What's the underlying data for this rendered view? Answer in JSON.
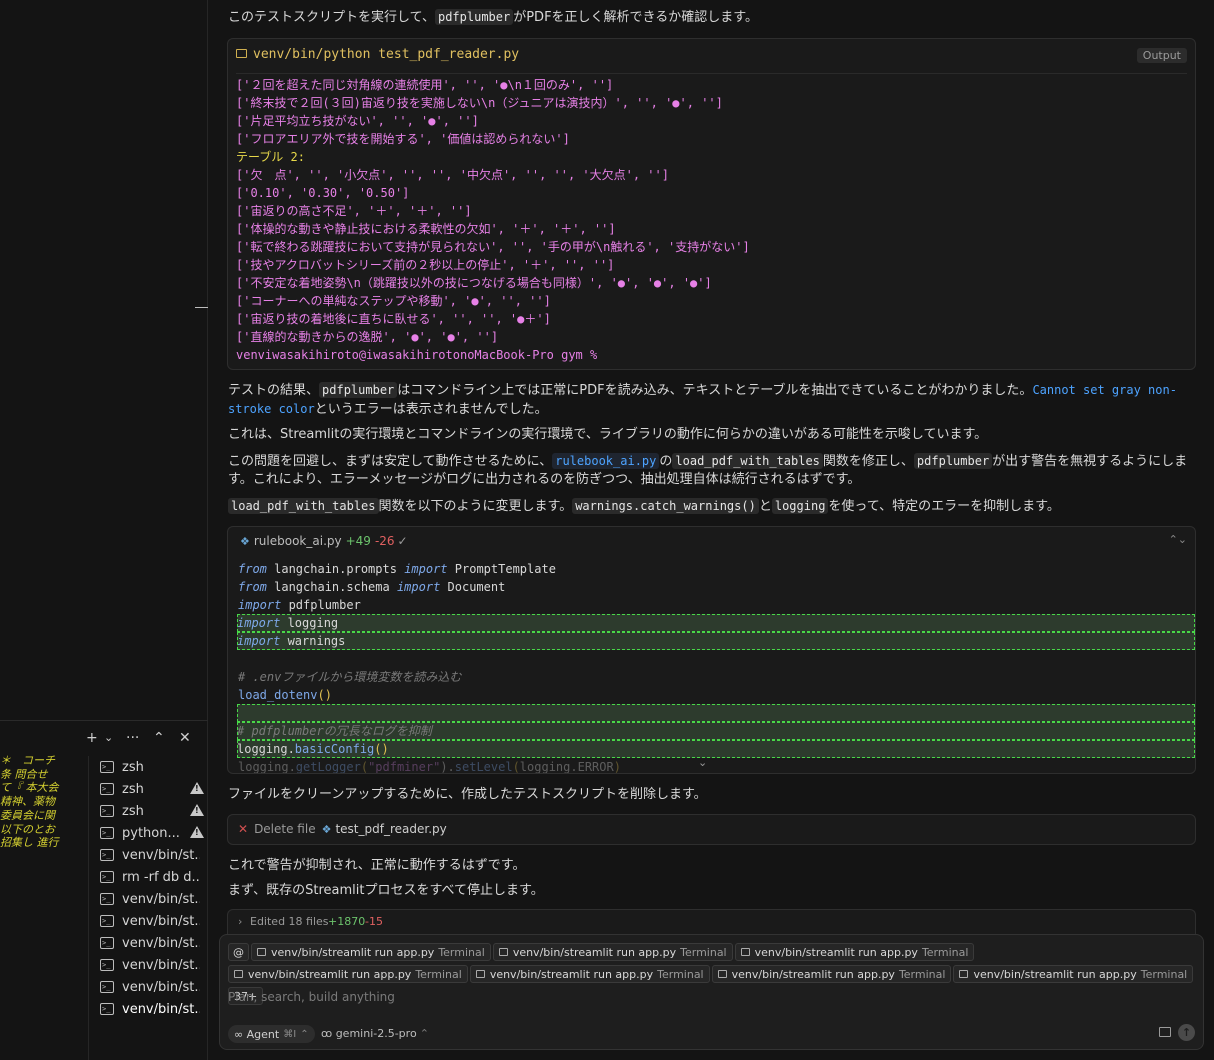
{
  "left": {
    "snippet_lines": [
      "＊　コーチ",
      "条 問合せ",
      "て『 本大会",
      "精神、薬物",
      "委員会に関",
      "以下のとお",
      "招集し 進行"
    ],
    "toolbar": {
      "add": "+",
      "add_chev": "⌄",
      "more": "···",
      "collapse": "⌃",
      "close": "✕"
    },
    "terminals": [
      {
        "label": "zsh",
        "warn": false
      },
      {
        "label": "zsh",
        "warn": true
      },
      {
        "label": "zsh",
        "warn": true
      },
      {
        "label": "python...",
        "warn": true
      },
      {
        "label": "venv/bin/st...",
        "warn": false
      },
      {
        "label": "rm -rf db d...",
        "warn": false
      },
      {
        "label": "venv/bin/st...",
        "warn": false
      },
      {
        "label": "venv/bin/st...",
        "warn": false
      },
      {
        "label": "venv/bin/st...",
        "warn": false
      },
      {
        "label": "venv/bin/st...",
        "warn": false
      },
      {
        "label": "venv/bin/st...",
        "warn": false
      },
      {
        "label": "venv/bin/st...",
        "warn": false,
        "active": true
      }
    ]
  },
  "chat": {
    "p1": {
      "a": "このテストスクリプトを実行して、",
      "code": "pdfplumber",
      "b": "がPDFを正しく解析できるか確認します。"
    },
    "output": {
      "command": "venv/bin/python test_pdf_reader.py",
      "tag": "Output",
      "lines": [
        "['２回を超えた同じ対角線の連続使用', '', '●\\n１回のみ', '']",
        "['終末技で２回(３回)宙返り技を実施しない\\n（ジュニアは演技内）', '', '●', '']",
        "['片足平均立ち技がない', '', '●', '']",
        "['フロアエリア外で技を開始する', '価値は認められない']",
        "テーブル 2:",
        "['欠　点', '', '小欠点', '', '', '中欠点', '', '', '大欠点', '']",
        "['0.10', '0.30', '0.50']",
        "['宙返りの高さ不足', '＋', '＋', '']",
        "['体操的な動きや静止技における柔軟性の欠如', '＋', '＋', '']",
        "['転で終わる跳躍技において支持が見られない', '', '手の甲が\\n触れる', '支持がない']",
        "['技やアクロバットシリーズ前の２秒以上の停止', '＋', '', '']",
        "['不安定な着地姿勢\\n（跳躍技以外の技につなげる場合も同様）', '●', '●', '●']",
        "['コーナーへの単純なステップや移動', '●', '', '']",
        "['宙返り技の着地後に直ちに臥せる', '', '', '●＋']",
        "['直線的な動きからの逸脱', '●', '●', '']",
        "venviwasakihiroto@iwasakihirotonoMacBook-Pro gym %"
      ]
    },
    "p2": {
      "a": "テストの結果、",
      "code": "pdfplumber",
      "b": "はコマンドライン上では正常にPDFを読み込み、テキストとテーブルを抽出できていることがわかりました。",
      "link": "Cannot set gray non-stroke color",
      "c": "というエラーは表示されませんでした。"
    },
    "p3": "これは、Streamlitの実行環境とコマンドラインの実行環境で、ライブラリの動作に何らかの違いがある可能性を示唆しています。",
    "p4": {
      "a": "この問題を回避し、まずは安定して動作させるために、",
      "link": "rulebook_ai.py",
      "b": "の",
      "code1": "load_pdf_with_tables",
      "c": "関数を修正し、",
      "code2": "pdfplumber",
      "d": "が出す警告を無視するようにします。これにより、エラーメッセージがログに出力されるのを防ぎつつ、抽出処理自体は続行されるはずです。"
    },
    "p5": {
      "code1": "load_pdf_with_tables",
      "a": "関数を以下のように変更します。",
      "code2": "warnings.catch_warnings()",
      "b": "と",
      "code3": "logging",
      "c": "を使って、特定のエラーを抑制します。"
    },
    "diff": {
      "file": "rulebook_ai.py",
      "added": "+49",
      "removed": "-26",
      "check": "✓",
      "toggle": "⌃⌄",
      "code": {
        "l1": {
          "kw1": "from",
          "m": " langchain.prompts ",
          "kw2": "import",
          "r": " PromptTemplate"
        },
        "l2": {
          "kw1": "from",
          "m": " langchain.schema ",
          "kw2": "import",
          "r": " Document"
        },
        "l3": {
          "kw1": "import",
          "r": " pdfplumber"
        },
        "l4": {
          "kw1": "import",
          "r": " logging"
        },
        "l5": {
          "kw1": "import",
          "r": " warnings"
        },
        "l7": "# .envファイルから環境変数を読み込む",
        "l8": {
          "fn": "load_dotenv",
          "br": "()"
        },
        "l10": "# pdfplumberの冗長なログを抑制",
        "l11": {
          "a": "logging.",
          "fn": "basicConfig",
          "br": "()"
        },
        "l12": {
          "a": "logging.",
          "fn": "getLogger",
          "s": "\"pdfminer\"",
          "b": ").",
          "fn2": "setLevel",
          "c": "logging.ERROR",
          "d": ")"
        },
        "chev": "⌄"
      }
    },
    "p6": "ファイルをクリーンアップするために、作成したテストスクリプトを削除します。",
    "delete": {
      "x": "✕",
      "label": "Delete file",
      "file": "test_pdf_reader.py"
    },
    "p7": "これで警告が抑制され、正常に動作するはずです。",
    "p8": "まず、既存のStreamlitプロセスをすべて停止します。"
  },
  "edited": {
    "chev": "›",
    "label": "Edited 18 files",
    "added": "+1870",
    "removed": "-15"
  },
  "composer": {
    "at": "@",
    "chips": [
      {
        "label": "venv/bin/streamlit run app.py",
        "suffix": "Terminal"
      },
      {
        "label": "venv/bin/streamlit run app.py",
        "suffix": "Terminal"
      },
      {
        "label": "venv/bin/streamlit run app.py",
        "suffix": "Terminal"
      },
      {
        "label": "venv/bin/streamlit run app.py",
        "suffix": "Terminal"
      },
      {
        "label": "venv/bin/streamlit run app.py",
        "suffix": "Terminal"
      },
      {
        "label": "venv/bin/streamlit run app.py",
        "suffix": "Terminal"
      },
      {
        "label": "venv/bin/streamlit run app.py",
        "suffix": "Terminal"
      }
    ],
    "more": "37+",
    "placeholder": "Plan, search, build anything",
    "agent": "∞ Agent",
    "agent_key": "⌘I",
    "agent_chev": "⌃",
    "model": "gemini-2.5-pro",
    "model_chev": "⌃",
    "send": "↑",
    "image_icon": "image-icon"
  }
}
